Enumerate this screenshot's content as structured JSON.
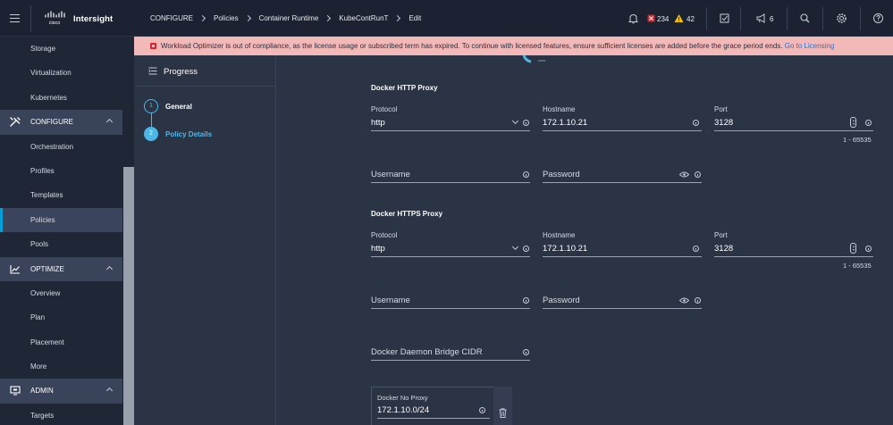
{
  "app": {
    "brand": "Intersight",
    "logo_text": "cisco"
  },
  "sidebar": {
    "items": [
      {
        "label": "Storage",
        "type": "item"
      },
      {
        "label": "Virtualization",
        "type": "item"
      },
      {
        "label": "Kubernetes",
        "type": "item"
      },
      {
        "label": "CONFIGURE",
        "type": "section",
        "icon": "wrench-icon"
      },
      {
        "label": "Orchestration",
        "type": "item"
      },
      {
        "label": "Profiles",
        "type": "item"
      },
      {
        "label": "Templates",
        "type": "item"
      },
      {
        "label": "Policies",
        "type": "item",
        "active": true
      },
      {
        "label": "Pools",
        "type": "item"
      },
      {
        "label": "OPTIMIZE",
        "type": "section",
        "icon": "chart-line-icon"
      },
      {
        "label": "Overview",
        "type": "item"
      },
      {
        "label": "Plan",
        "type": "item"
      },
      {
        "label": "Placement",
        "type": "item"
      },
      {
        "label": "More",
        "type": "item"
      },
      {
        "label": "ADMIN",
        "type": "section",
        "icon": "monitor-icon"
      },
      {
        "label": "Targets",
        "type": "item"
      }
    ]
  },
  "header": {
    "breadcrumb": [
      "CONFIGURE",
      "Policies",
      "Container Runtime",
      "KubeContRunT",
      "Edit"
    ],
    "alarms_critical": "234",
    "alarms_warning": "42",
    "announcements": "6",
    "icons": [
      "bell-icon",
      "critical-alarm-icon",
      "warning-alarm-icon",
      "tasks-icon",
      "megaphone-icon",
      "search-icon",
      "gear-icon",
      "help-icon"
    ]
  },
  "banner": {
    "message": "Workload Optimizer is out of compliance, as the license usage or subscribed term has expired. To continue with licensed features, ensure sufficient licenses are added before the grace period ends.",
    "link": "Go to Licensing",
    "color": "#f3b9b9"
  },
  "progress": {
    "title": "Progress",
    "steps": [
      {
        "number": "1",
        "label": "General"
      },
      {
        "number": "2",
        "label": "Policy Details"
      }
    ]
  },
  "form": {
    "http_proxy": {
      "title": "Docker HTTP Proxy",
      "protocol_label": "Protocol",
      "protocol_value": "http",
      "hostname_label": "Hostname",
      "hostname_value": "172.1.10.21",
      "port_label": "Port",
      "port_value": "3128",
      "port_range": "1 - 65535",
      "username_placeholder": "Username",
      "password_placeholder": "Password"
    },
    "https_proxy": {
      "title": "Docker HTTPS Proxy",
      "protocol_label": "Protocol",
      "protocol_value": "http",
      "hostname_label": "Hostname",
      "hostname_value": "172.1.10.21",
      "port_label": "Port",
      "port_value": "3128",
      "port_range": "1 - 65535",
      "username_placeholder": "Username",
      "password_placeholder": "Password"
    },
    "bridge_cidr_placeholder": "Docker Daemon Bridge CIDR",
    "no_proxy_label": "Docker No Proxy",
    "no_proxy_value": "172.1.10.0/24"
  },
  "colors": {
    "accent": "#49b8e8",
    "sidebar_bg": "#1f2636",
    "main_bg": "#2b3445",
    "critical": "#d9262c",
    "warning": "#f5c400"
  }
}
